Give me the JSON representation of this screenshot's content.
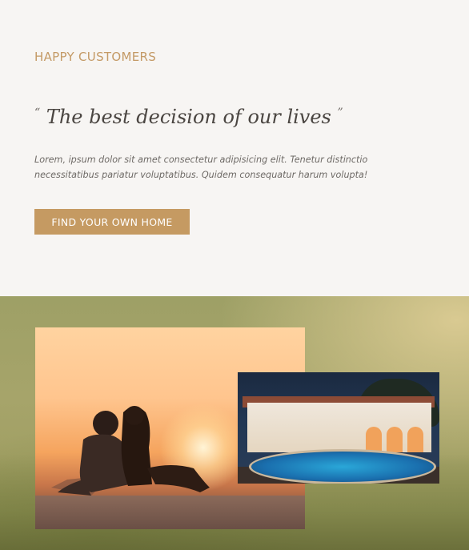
{
  "section": {
    "eyebrow": "HAPPY CUSTOMERS",
    "quote_open": "“",
    "quote_text": "The best decision of our lives",
    "quote_close": "”",
    "body": "Lorem, ipsum dolor sit amet consectetur adipisicing elit. Tenetur distinctio necessitatibus pariatur voluptatibus. Quidem consequatur harum volupta!",
    "cta_label": "FIND YOUR OWN HOME"
  },
  "colors": {
    "accent": "#c59a62",
    "background": "#f7f5f3",
    "heading_text": "#4a4541",
    "body_text": "#6e6a66"
  },
  "images": {
    "primary": "sunset-couple-photo",
    "secondary": "villa-pool-photo"
  }
}
